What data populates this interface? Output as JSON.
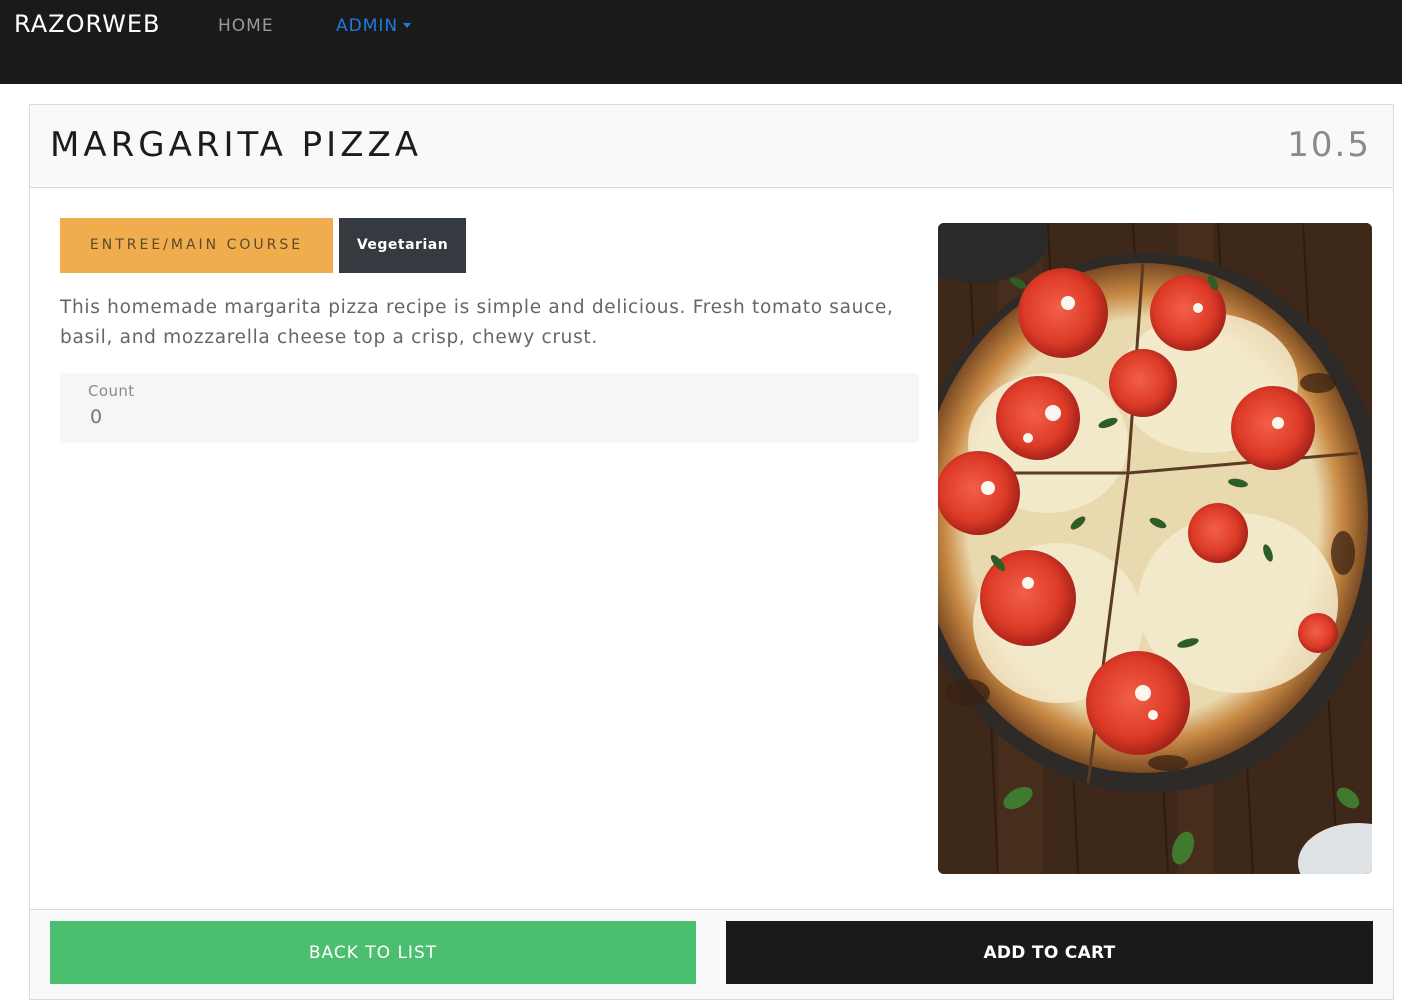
{
  "navbar": {
    "brand": "RAZORWEB",
    "home_label": "HOME",
    "admin_label": "ADMIN"
  },
  "product": {
    "title": "MARGARITA PIZZA",
    "price": "10.5",
    "category_badge": "ENTREE/MAIN COURSE",
    "diet_badge": "Vegetarian",
    "description": "This homemade margarita pizza recipe is simple and delicious. Fresh tomato sauce, basil, and mozzarella cheese top a crisp, chewy crust.",
    "count_label": "Count",
    "count_value": "0"
  },
  "actions": {
    "back_label": "BACK TO LIST",
    "cart_label": "ADD TO CART"
  },
  "colors": {
    "navbar_bg": "#1a1a1a",
    "admin_link": "#1f7ae0",
    "category_badge_bg": "#f0ad4e",
    "diet_badge_bg": "#343a40",
    "back_button_bg": "#4cbe70",
    "cart_button_bg": "#1a1a1a"
  }
}
